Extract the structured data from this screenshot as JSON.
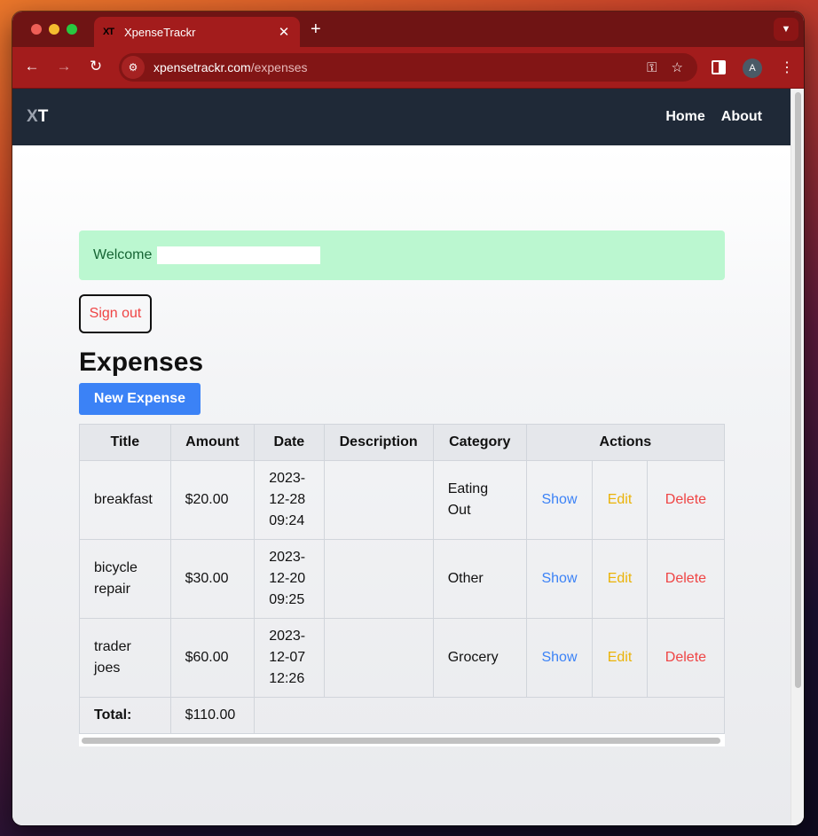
{
  "browser": {
    "tab_title": "XpenseTrackr",
    "tab_favicon": "XT",
    "url_host": "xpensetrackr.com",
    "url_path": "/expenses",
    "avatar_letter": "A"
  },
  "nav": {
    "brand_x": "X",
    "brand_t": "T",
    "links": [
      "Home",
      "About"
    ]
  },
  "page": {
    "welcome": "Welcome",
    "signout": "Sign out",
    "heading": "Expenses",
    "new_expense": "New Expense"
  },
  "table": {
    "headers": [
      "Title",
      "Amount",
      "Date",
      "Description",
      "Category",
      "Actions"
    ],
    "rows": [
      {
        "title": "breakfast",
        "amount": "$20.00",
        "date": "2023-\n12-28\n09:24",
        "description": "",
        "category": "Eating\nOut",
        "show": "Show",
        "edit": "Edit",
        "delete": "Delete"
      },
      {
        "title": "bicycle\nrepair",
        "amount": "$30.00",
        "date": "2023-\n12-20\n09:25",
        "description": "",
        "category": "Other",
        "show": "Show",
        "edit": "Edit",
        "delete": "Delete"
      },
      {
        "title": "trader\njoes",
        "amount": "$60.00",
        "date": "2023-\n12-07\n12:26",
        "description": "",
        "category": "Grocery",
        "show": "Show",
        "edit": "Edit",
        "delete": "Delete"
      }
    ],
    "total_label": "Total:",
    "total_amount": "$110.00"
  },
  "colors": {
    "browser_frame": "#a31c1c",
    "navbar": "#1f2937",
    "alert_bg": "#bbf7d0",
    "primary": "#3b82f6",
    "warning": "#eab308",
    "danger": "#ef4444"
  },
  "icons": [
    "back-arrow-icon",
    "forward-arrow-icon",
    "reload-icon",
    "site-info-icon",
    "key-icon",
    "star-icon",
    "side-panel-icon",
    "menu-dots-icon",
    "close-icon",
    "plus-icon",
    "chevron-down-icon"
  ]
}
